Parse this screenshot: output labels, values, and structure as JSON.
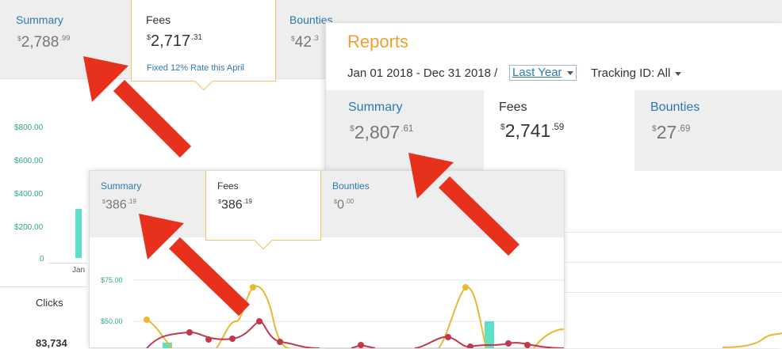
{
  "panel_a": {
    "summary": {
      "label": "Summary",
      "currency": "$",
      "whole": "2,788",
      "cents": ".99"
    },
    "fees": {
      "label": "Fees",
      "currency": "$",
      "whole": "2,717",
      "cents": ".31",
      "note": "Fixed 12% Rate this April"
    },
    "bounties": {
      "label": "Bounties",
      "currency": "$",
      "whole": "42",
      "cents": ".3"
    },
    "chart": {
      "y_ticks": [
        "$800.00",
        "$600.00",
        "$400.00",
        "$200.00",
        "0"
      ],
      "x_label_partial": "Jan"
    },
    "clicks": {
      "label": "Clicks",
      "value": "83,734"
    }
  },
  "panel_b": {
    "title": "Reports",
    "date_range": "Jan 01 2018 - Dec 31 2018 /",
    "period_select": "Last Year",
    "tracking": "Tracking ID: All",
    "summary": {
      "label": "Summary",
      "currency": "$",
      "whole": "2,807",
      "cents": ".61"
    },
    "fees": {
      "label": "Fees",
      "currency": "$",
      "whole": "2,741",
      "cents": ".59"
    },
    "bounties": {
      "label": "Bounties",
      "currency": "$",
      "whole": "27",
      "cents": ".69"
    }
  },
  "panel_c": {
    "summary": {
      "label": "Summary",
      "currency": "$",
      "whole": "386",
      "cents": ".19"
    },
    "fees": {
      "label": "Fees",
      "currency": "$",
      "whole": "386",
      "cents": ".19"
    },
    "bounties": {
      "label": "Bounties",
      "currency": "$",
      "whole": "0",
      "cents": ".00"
    },
    "chart": {
      "y_ticks": [
        "$75.00",
        "$50.00"
      ]
    }
  },
  "colors": {
    "link_blue": "#2a7ab0",
    "accent_orange": "#f0a030",
    "arrow_red": "#e8311d",
    "teal_bar": "#5de0c6",
    "series_red": "#c0394b",
    "series_yellow": "#e8b830"
  }
}
